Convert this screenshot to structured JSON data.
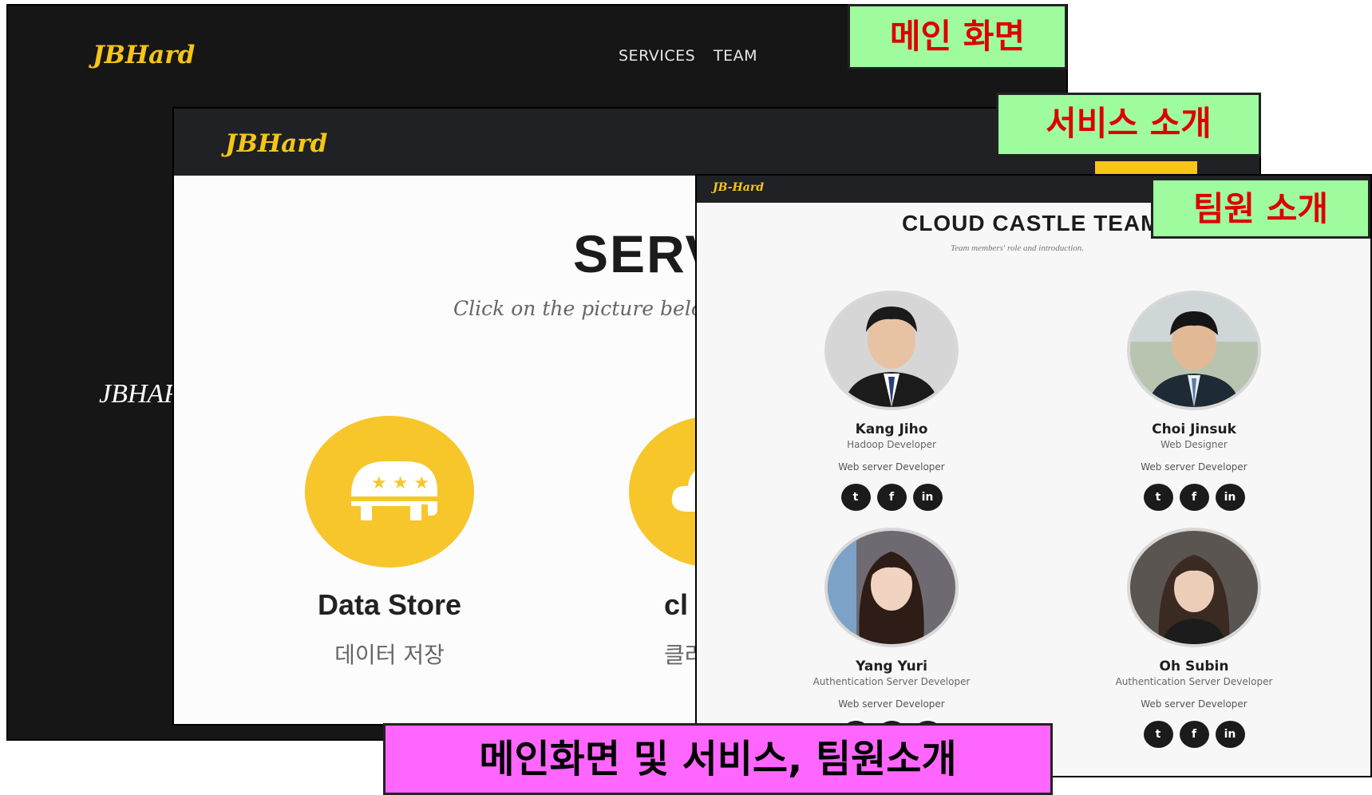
{
  "main_screen": {
    "logo": "JBHard",
    "nav": [
      "SERVICES",
      "TEAM"
    ],
    "hero_text": "JBHAR"
  },
  "services": {
    "logo": "JBHard",
    "title": "SERV",
    "subtitle": "Click on the picture belo",
    "items": [
      {
        "name": "Data Store",
        "desc": "데이터 저장",
        "icon": "elephant-icon"
      },
      {
        "name": "cl",
        "desc": "클라",
        "icon": "cloud-icon"
      }
    ]
  },
  "team": {
    "logo": "JB-Hard",
    "title": "CLOUD CASTLE TEAM",
    "subtitle": "Team members' role and introduction.",
    "members": [
      {
        "name": "Kang Jiho",
        "role": "Hadoop Developer",
        "dev": "Web server Developer"
      },
      {
        "name": "Choi Jinsuk",
        "role": "Web Designer",
        "dev": "Web server Developer"
      },
      {
        "name": "Yang Yuri",
        "role": "Authentication Server Developer",
        "dev": "Web server Developer"
      },
      {
        "name": "Oh Subin",
        "role": "Authentication Server Developer",
        "dev": "Web server Developer"
      }
    ],
    "social_icons": [
      "twitter-icon",
      "facebook-icon",
      "linkedin-icon"
    ]
  },
  "labels": {
    "main": "메인 화면",
    "services": "서비스 소개",
    "team": "팀원 소개",
    "summary": "메인화면 및 서비스, 팀원소개"
  },
  "colors": {
    "accent": "#f7c62b",
    "label_green": "#9efc9e",
    "label_text_red": "#dd0000",
    "summary_magenta": "#ff66ff",
    "dark_bar": "#202124"
  }
}
